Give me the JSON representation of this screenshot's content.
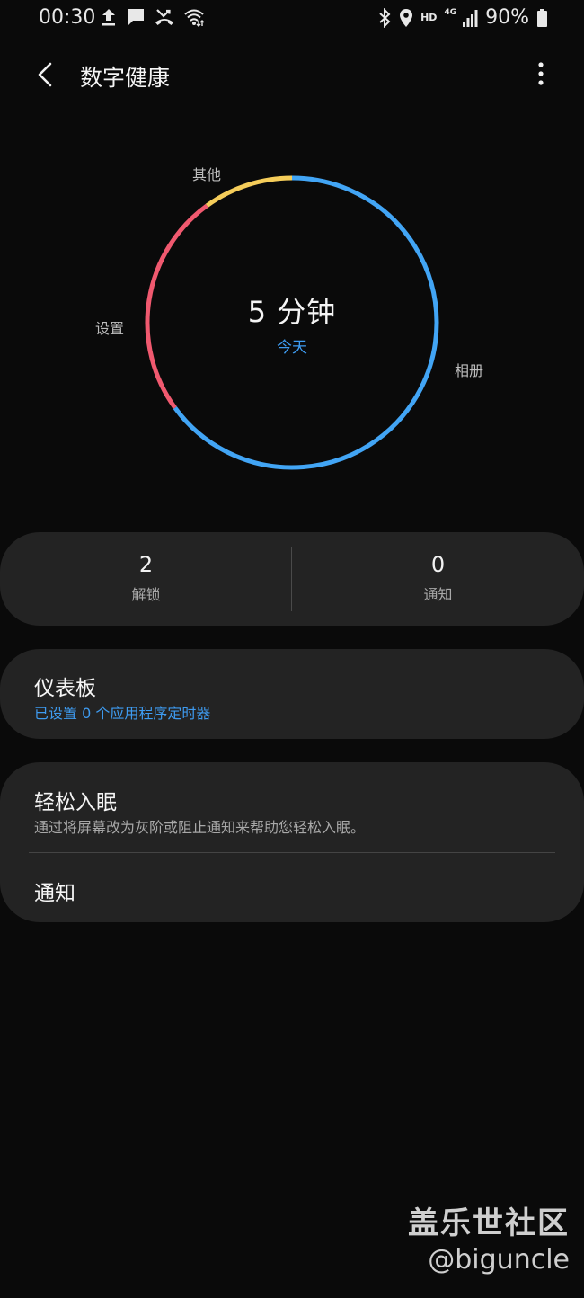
{
  "status_bar": {
    "time": "00:30",
    "network_hd": "HD",
    "network_4g": "4G",
    "battery": "90%",
    "icons": [
      "upload-icon",
      "message-icon",
      "missed-call-icon",
      "wifi-icon",
      "bluetooth-icon",
      "location-icon",
      "signal-icon",
      "battery-icon"
    ]
  },
  "app_bar": {
    "title": "数字健康",
    "back_icon": "back-arrow-icon",
    "more_icon": "more-vert-icon"
  },
  "usage": {
    "total": "5 分钟",
    "period": "今天",
    "segments": [
      {
        "label": "相册",
        "color": "#42a5f5",
        "fraction": 0.65
      },
      {
        "label": "设置",
        "color": "#f0596f",
        "fraction": 0.25
      },
      {
        "label": "其他",
        "color": "#f5cd5a",
        "fraction": 0.1
      }
    ]
  },
  "stats": {
    "unlocks_value": "2",
    "unlocks_label": "解锁",
    "notifications_value": "0",
    "notifications_label": "通知"
  },
  "dashboard": {
    "title": "仪表板",
    "subtitle": "已设置 0 个应用程序定时器"
  },
  "wind_down": {
    "title": "轻松入眠",
    "subtitle": "通过将屏幕改为灰阶或阻止通知来帮助您轻松入眠。"
  },
  "notifications_row": {
    "title": "通知"
  },
  "watermark": {
    "title": "盖乐世社区",
    "handle": "@biguncle"
  }
}
